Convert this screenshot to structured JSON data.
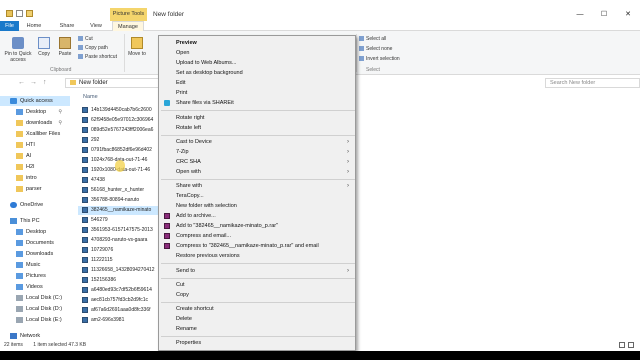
{
  "window": {
    "context_tab": "Picture Tools",
    "title": "New folder",
    "ctrl_min": "—",
    "ctrl_max": "☐",
    "ctrl_close": "✕"
  },
  "ribbon_tabs": {
    "file": "File",
    "home": "Home",
    "share": "Share",
    "view": "View",
    "manage": "Manage"
  },
  "ribbon": {
    "pin_label": "Pin to Quick access",
    "copy_label": "Copy",
    "paste_label": "Paste",
    "cut_label": "Cut",
    "copy_path_label": "Copy path",
    "paste_shortcut_label": "Paste shortcut",
    "move_to_label": "Move to",
    "clipboard_group": "Clipboard",
    "select_all": "Select all",
    "select_none": "Select none",
    "invert_selection": "Invert selection",
    "select_group": "Select"
  },
  "address": {
    "back": "←",
    "forward": "→",
    "up": "↑",
    "path": "New folder",
    "search_placeholder": "Search New folder"
  },
  "nav": {
    "quick_access": "Quick access",
    "desktop": "Desktop",
    "downloads": "downloads",
    "xcalliber": "Xcalliber Files",
    "hti": "HTI",
    "ai": "AI",
    "h2i": "H2I",
    "intro": "intro",
    "parser": "parser",
    "onedrive": "OneDrive",
    "this_pc": "This PC",
    "desktop2": "Desktop",
    "documents": "Documents",
    "downloads2": "Downloads",
    "music": "Music",
    "pictures": "Pictures",
    "videos": "Videos",
    "disk_c": "Local Disk (C:)",
    "disk_d": "Local Disk (D:)",
    "disk_e": "Local Disk (E:)",
    "network": "Network"
  },
  "files": {
    "header": "Name",
    "items": [
      "14b139d4450cab7b6c2600",
      "62f9458e05e97012c306964",
      "089d52e5767243fff2006ea6",
      "292",
      "0791fbac86852df6e96d402",
      "1024x768-data-out-71-46",
      "1920x1080-data-out-71-46",
      "47438",
      "56168_hunter_x_hunter",
      "356788-80894-naruto",
      "382465__namikaze-minato",
      "546279",
      "3561953-6157147575-2013",
      "4708293-naruto-vs-gaara",
      "10729076",
      "11222115",
      "11326658_14328094270412",
      "152156386",
      "a6480ed93c7df52b6f59614",
      "aec81cb757fd3cb2d9fc1c",
      "af67a6d2691aaa0d8fc336f",
      "am2-696x3981"
    ]
  },
  "status": {
    "count": "22 items",
    "selected": "1 item selected  47.3 KB"
  },
  "menu": {
    "preview": "Preview",
    "open": "Open",
    "upload": "Upload to Web Albums...",
    "set_bg": "Set as desktop background",
    "edit": "Edit",
    "print": "Print",
    "shareit": "Share files via SHAREit",
    "rotate_right": "Rotate right",
    "rotate_left": "Rotate left",
    "cast": "Cast to Device",
    "zip": "7-Zip",
    "crc": "CRC SHA",
    "open_with": "Open with",
    "share_with": "Share with",
    "teracopy": "TeraCopy...",
    "new_folder_sel": "New folder with selection",
    "add_archive": "Add to archive...",
    "add_rar": "Add to \"382465__namikaze-minato_p.rar\"",
    "compress_email": "Compress and email...",
    "compress_rar_email": "Compress to \"382465__namikaze-minato_p.rar\" and email",
    "restore": "Restore previous versions",
    "send_to": "Send to",
    "cut": "Cut",
    "copy": "Copy",
    "create_shortcut": "Create shortcut",
    "delete": "Delete",
    "rename": "Rename",
    "properties": "Properties",
    "arrow": "›"
  }
}
